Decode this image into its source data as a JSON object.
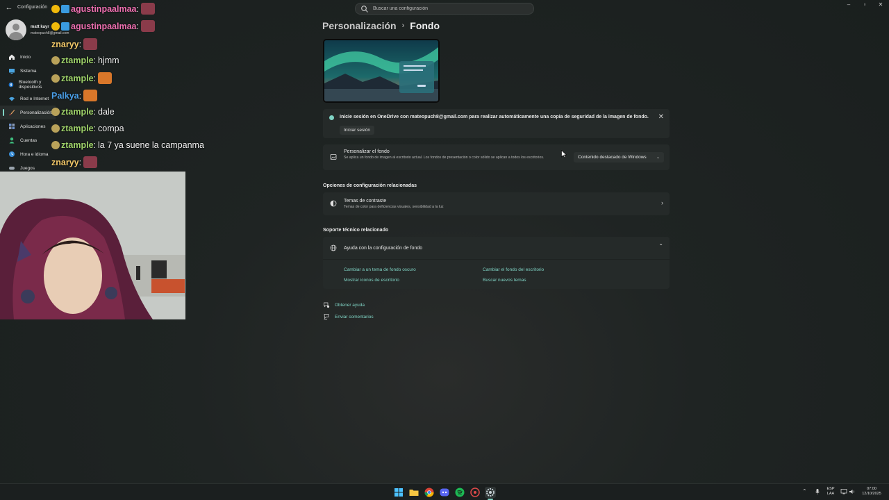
{
  "window": {
    "app_title": "Configuración",
    "search_placeholder": "Buscar una configuración",
    "controls": {
      "minimize": "–",
      "maximize": "▫",
      "close": "✕"
    }
  },
  "user": {
    "name": "matt kayr",
    "email": "mateopuch8@gmail.com"
  },
  "sidebar": {
    "items": [
      {
        "label": "Inicio",
        "icon": "home-icon"
      },
      {
        "label": "Sistema",
        "icon": "monitor-icon"
      },
      {
        "label": "Bluetooth y dispositivos",
        "icon": "bluetooth-icon"
      },
      {
        "label": "Red e Internet",
        "icon": "wifi-icon"
      },
      {
        "label": "Personalización",
        "icon": "brush-icon",
        "active": true
      },
      {
        "label": "Aplicaciones",
        "icon": "apps-icon"
      },
      {
        "label": "Cuentas",
        "icon": "person-icon"
      },
      {
        "label": "Hora e idioma",
        "icon": "globe-clock-icon"
      },
      {
        "label": "Juegos",
        "icon": "gamepad-icon"
      }
    ]
  },
  "chat": {
    "messages": [
      {
        "user": "agustinpaalmaa",
        "text": ""
      },
      {
        "user": "agustinpaalmaa",
        "text": ""
      },
      {
        "user": "znaryy",
        "text": ""
      },
      {
        "user": "ztample",
        "text": "hjmm"
      },
      {
        "user": "ztample",
        "text": ""
      },
      {
        "user": "Palkya",
        "text": ""
      },
      {
        "user": "ztample",
        "text": "dale"
      },
      {
        "user": "ztample",
        "text": "compa"
      },
      {
        "user": "ztample",
        "text": "la 7 ya suene la campanma"
      },
      {
        "user": "znaryy",
        "text": ""
      }
    ]
  },
  "main": {
    "breadcrumb": {
      "parent": "Personalización",
      "separator": "›",
      "current": "Fondo"
    },
    "onedrive_notice": {
      "text": "Inicie sesión en OneDrive con mateopuch8@gmail.com para realizar automáticamente una copia de seguridad de la imagen de fondo.",
      "button": "Iniciar sesión"
    },
    "personalize": {
      "title": "Personalizar el fondo",
      "description": "Se aplica un fondo de imagen al escritorio actual. Los fondos de presentación o color sólido se aplican a todos los escritorios.",
      "dropdown_value": "Contenido destacado de Windows"
    },
    "related_settings": {
      "heading": "Opciones de configuración relacionadas",
      "contrast": {
        "title": "Temas de contraste",
        "description": "Temas de color para deficiencias visuales, sensibilidad a la luz"
      }
    },
    "support": {
      "heading": "Soporte técnico relacionado",
      "help_title": "Ayuda con la configuración de fondo",
      "links": [
        "Cambiar a un tema de fondo oscuro",
        "Cambiar el fondo del escritorio",
        "Mostrar iconos de escritorio",
        "Buscar nuevos temas"
      ]
    },
    "footer": {
      "get_help": "Obtener ayuda",
      "send_feedback": "Enviar comentarios"
    }
  },
  "taskbar": {
    "icons": [
      "windows-start-icon",
      "file-explorer-icon",
      "chrome-icon",
      "discord-icon",
      "spotify-icon",
      "app-icon",
      "settings-icon"
    ],
    "language": "ESP",
    "layout": "LAA",
    "time": "07:00",
    "date": "12/10/2025"
  },
  "colors": {
    "accent": "#7fd3c4",
    "background": "#1f2423",
    "card": "#252a29"
  }
}
